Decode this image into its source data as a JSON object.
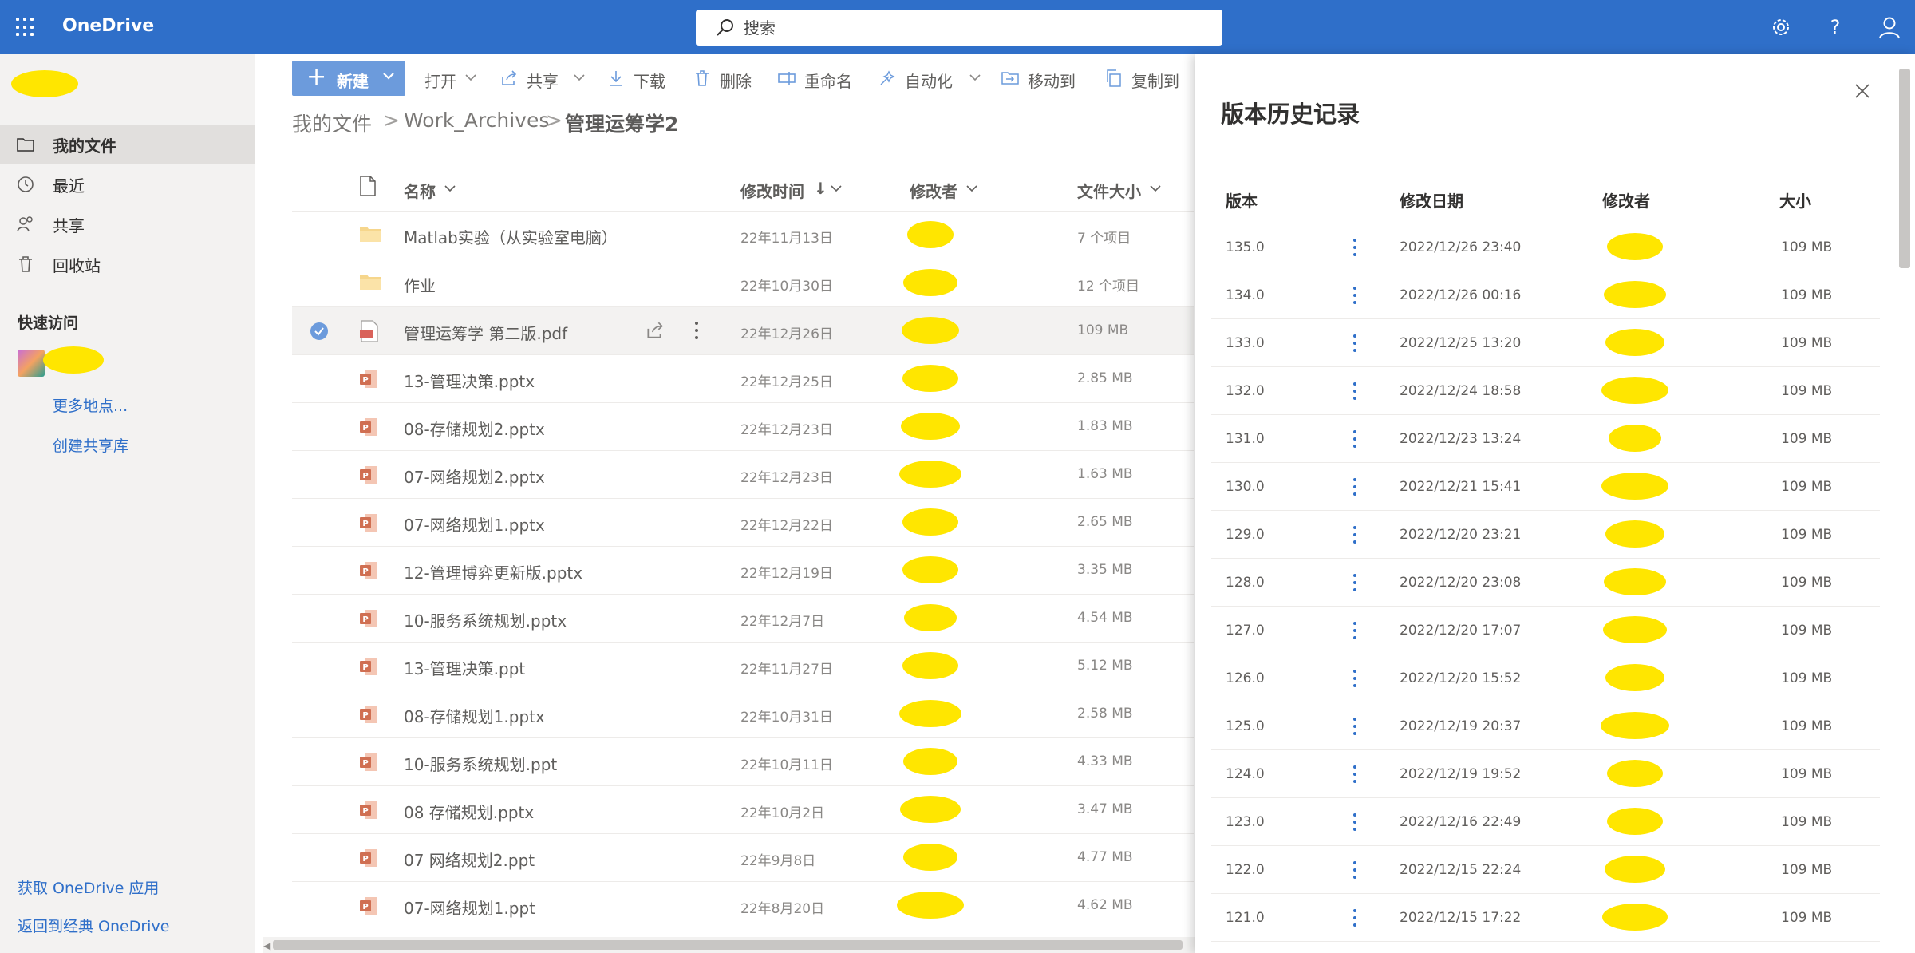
{
  "app": {
    "name": "OneDrive"
  },
  "search": {
    "placeholder": "搜索"
  },
  "topbar_icons": [
    "settings-icon",
    "help-icon",
    "account-icon"
  ],
  "nav": {
    "items": [
      {
        "label": "我的文件",
        "icon": "folder-icon",
        "selected": true
      },
      {
        "label": "最近",
        "icon": "history-icon",
        "selected": false
      },
      {
        "label": "共享",
        "icon": "people-icon",
        "selected": false
      },
      {
        "label": "回收站",
        "icon": "recycle-bin-icon",
        "selected": false
      }
    ],
    "quick_access_title": "快速访问",
    "more_places": "更多地点...",
    "create_library": "创建共享库",
    "get_app": "获取 OneDrive 应用",
    "classic": "返回到经典 OneDrive"
  },
  "toolbar": {
    "new_label": "新建",
    "open_label": "打开",
    "share_label": "共享",
    "download_label": "下载",
    "delete_label": "删除",
    "rename_label": "重命名",
    "automate_label": "自动化",
    "move_label": "移动到",
    "copy_label": "复制到"
  },
  "breadcrumb": {
    "items": [
      "我的文件",
      "Work_Archives",
      "管理运筹学2"
    ]
  },
  "columns": {
    "name": "名称",
    "modified": "修改时间",
    "modified_sort": "↓",
    "modifier": "修改者",
    "size": "文件大小"
  },
  "files": [
    {
      "name": "Matlab实验（从实验室电脑）",
      "type": "folder",
      "modified": "22年11月13日",
      "size": "7 个项目",
      "selected": false
    },
    {
      "name": "作业",
      "type": "folder",
      "modified": "22年10月30日",
      "size": "12 个项目",
      "selected": false
    },
    {
      "name": "管理运筹学 第二版.pdf",
      "type": "pdf",
      "modified": "22年12月26日",
      "size": "109 MB",
      "selected": true
    },
    {
      "name": "13-管理决策.pptx",
      "type": "ppt",
      "modified": "22年12月25日",
      "size": "2.85 MB",
      "selected": false
    },
    {
      "name": "08-存储规划2.pptx",
      "type": "ppt",
      "modified": "22年12月23日",
      "size": "1.83 MB",
      "selected": false
    },
    {
      "name": "07-网络规划2.pptx",
      "type": "ppt",
      "modified": "22年12月23日",
      "size": "1.63 MB",
      "selected": false
    },
    {
      "name": "07-网络规划1.pptx",
      "type": "ppt",
      "modified": "22年12月22日",
      "size": "2.65 MB",
      "selected": false
    },
    {
      "name": "12-管理博弈更新版.pptx",
      "type": "ppt",
      "modified": "22年12月19日",
      "size": "3.35 MB",
      "selected": false
    },
    {
      "name": "10-服务系统规划.pptx",
      "type": "ppt",
      "modified": "22年12月7日",
      "size": "4.54 MB",
      "selected": false
    },
    {
      "name": "13-管理决策.ppt",
      "type": "ppt",
      "modified": "22年11月27日",
      "size": "5.12 MB",
      "selected": false
    },
    {
      "name": "08-存储规划1.pptx",
      "type": "ppt",
      "modified": "22年10月31日",
      "size": "2.58 MB",
      "selected": false
    },
    {
      "name": "10-服务系统规划.ppt",
      "type": "ppt",
      "modified": "22年10月11日",
      "size": "4.33 MB",
      "selected": false
    },
    {
      "name": "08 存储规划.pptx",
      "type": "ppt",
      "modified": "22年10月2日",
      "size": "3.47 MB",
      "selected": false
    },
    {
      "name": "07 网络规划2.ppt",
      "type": "ppt",
      "modified": "22年9月8日",
      "size": "4.77 MB",
      "selected": false
    },
    {
      "name": "07-网络规划1.ppt",
      "type": "ppt",
      "modified": "22年8月20日",
      "size": "4.62 MB",
      "selected": false
    }
  ],
  "version_panel": {
    "title": "版本历史记录",
    "col_version": "版本",
    "col_date": "修改日期",
    "col_modifier": "修改者",
    "col_size": "大小",
    "versions": [
      {
        "version": "135.0",
        "date": "2022/12/26 23:40",
        "size": "109 MB"
      },
      {
        "version": "134.0",
        "date": "2022/12/26 00:16",
        "size": "109 MB"
      },
      {
        "version": "133.0",
        "date": "2022/12/25 13:20",
        "size": "109 MB"
      },
      {
        "version": "132.0",
        "date": "2022/12/24 18:58",
        "size": "109 MB"
      },
      {
        "version": "131.0",
        "date": "2022/12/23 13:24",
        "size": "109 MB"
      },
      {
        "version": "130.0",
        "date": "2022/12/21 15:41",
        "size": "109 MB"
      },
      {
        "version": "129.0",
        "date": "2022/12/20 23:21",
        "size": "109 MB"
      },
      {
        "version": "128.0",
        "date": "2022/12/20 23:08",
        "size": "109 MB"
      },
      {
        "version": "127.0",
        "date": "2022/12/20 17:07",
        "size": "109 MB"
      },
      {
        "version": "126.0",
        "date": "2022/12/20 15:52",
        "size": "109 MB"
      },
      {
        "version": "125.0",
        "date": "2022/12/19 20:37",
        "size": "109 MB"
      },
      {
        "version": "124.0",
        "date": "2022/12/19 19:52",
        "size": "109 MB"
      },
      {
        "version": "123.0",
        "date": "2022/12/16 22:49",
        "size": "109 MB"
      },
      {
        "version": "122.0",
        "date": "2022/12/15 22:24",
        "size": "109 MB"
      },
      {
        "version": "121.0",
        "date": "2022/12/15 17:22",
        "size": "109 MB"
      }
    ]
  },
  "colors": {
    "brand": "#2f6fc9",
    "new_button": "#6c9bdc",
    "redaction": "#ffe600",
    "selected_row": "#f3f2f1"
  }
}
